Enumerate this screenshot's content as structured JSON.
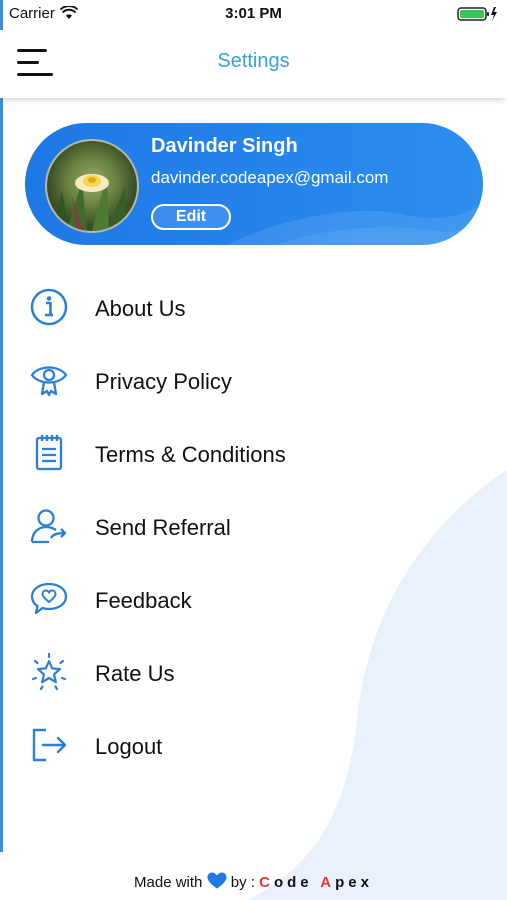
{
  "status_bar": {
    "carrier": "Carrier",
    "time": "3:01 PM"
  },
  "header": {
    "title": "Settings"
  },
  "profile": {
    "name": "Davinder Singh",
    "email": "davinder.codeapex@gmail.com",
    "edit_label": "Edit"
  },
  "menu": {
    "items": [
      {
        "label": "About Us",
        "icon": "info-icon"
      },
      {
        "label": "Privacy Policy",
        "icon": "eye-privacy-icon"
      },
      {
        "label": "Terms & Conditions",
        "icon": "notepad-icon"
      },
      {
        "label": "Send Referral",
        "icon": "user-referral-icon"
      },
      {
        "label": "Feedback",
        "icon": "chat-heart-icon"
      },
      {
        "label": "Rate Us",
        "icon": "star-icon"
      },
      {
        "label": "Logout",
        "icon": "logout-icon"
      }
    ]
  },
  "footer": {
    "made_with": "Made with",
    "by": "by :",
    "brand_c": "C",
    "brand_ode": "ode",
    "brand_a": "A",
    "brand_pex": "pex"
  },
  "colors": {
    "accent": "#3aa0db",
    "brand_blue": "#1e78e6",
    "icon_blue": "#2b7fd6",
    "brand_red": "#e53935"
  }
}
